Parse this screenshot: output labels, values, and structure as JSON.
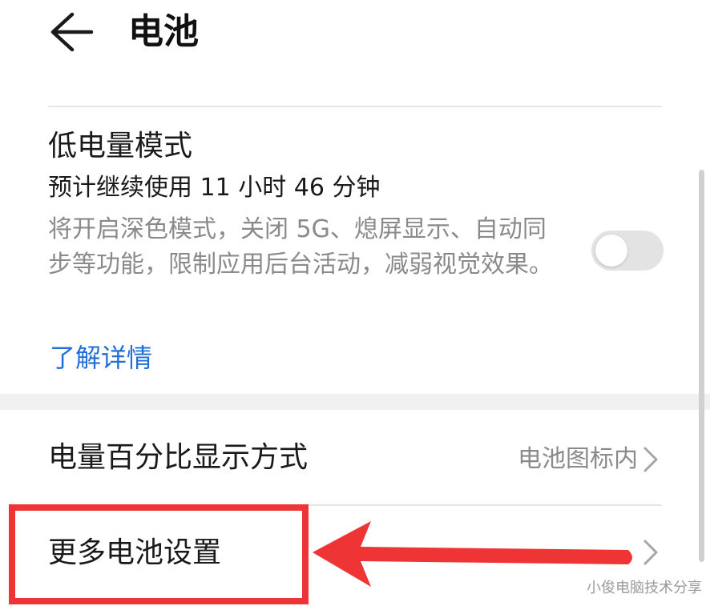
{
  "header": {
    "back_icon": "arrow-left-icon",
    "title": "电池"
  },
  "low_power_mode": {
    "title": "低电量模式",
    "estimate": "预计继续使用 11 小时 46 分钟",
    "description": "将开启深色模式，关闭 5G、熄屏显示、自动同步等功能，限制应用后台活动，减弱视觉效果。",
    "learn_more": "了解详情",
    "toggle_on": false
  },
  "settings": [
    {
      "label": "电量百分比显示方式",
      "value": "电池图标内",
      "icon": "chevron-right-icon"
    },
    {
      "label": "更多电池设置",
      "value": "",
      "icon": "chevron-right-icon"
    }
  ],
  "annotation": {
    "highlight_color": "#ee3434",
    "arrow_color": "#ee3434"
  },
  "watermark": "小俊电脑技术分享",
  "colors": {
    "accent": "#1f6fd6",
    "secondary_text": "#8a8a8a",
    "divider": "#e6e6e6"
  }
}
